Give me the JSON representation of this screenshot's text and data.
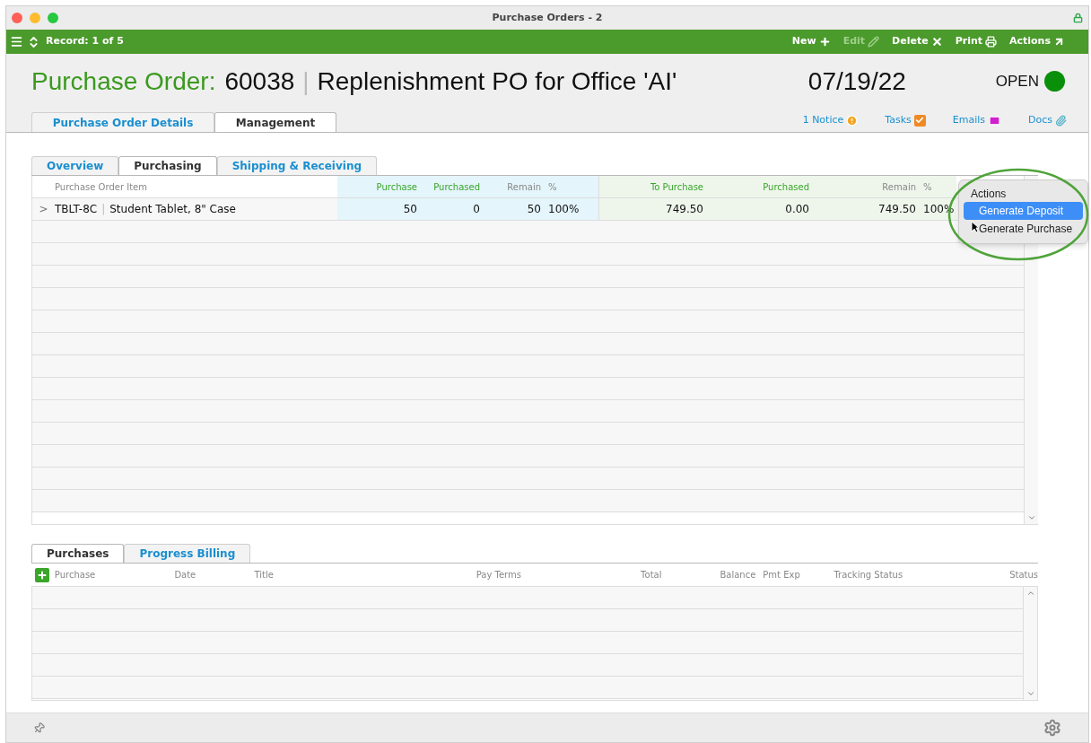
{
  "window": {
    "title": "Purchase Orders - 2"
  },
  "toolbar": {
    "record": "Record: 1 of 5",
    "buttons": [
      {
        "label": "New",
        "kind": "new",
        "disabled": false
      },
      {
        "label": "Edit",
        "kind": "edit",
        "disabled": true
      },
      {
        "label": "Delete",
        "kind": "delete",
        "disabled": false
      },
      {
        "label": "Print",
        "kind": "print",
        "disabled": false
      },
      {
        "label": "Actions",
        "kind": "actions",
        "disabled": false
      }
    ]
  },
  "header": {
    "label": "Purchase Order:",
    "number": "60038",
    "separator": "|",
    "title": "Replenishment PO for Office 'AI'",
    "date": "07/19/22",
    "status": "OPEN"
  },
  "tabs": [
    {
      "label": "Purchase Order Details",
      "selected": false
    },
    {
      "label": "Management",
      "selected": true
    }
  ],
  "links": [
    {
      "label": "1 Notice",
      "kind": "notice"
    },
    {
      "label": "Tasks",
      "kind": "tasks"
    },
    {
      "label": "Emails",
      "kind": "emails"
    },
    {
      "label": "Docs",
      "kind": "docs"
    }
  ],
  "sub_tabs": [
    {
      "label": "Overview",
      "selected": false
    },
    {
      "label": "Purchasing",
      "selected": true
    },
    {
      "label": "Shipping & Receiving",
      "selected": false
    }
  ],
  "items_table": {
    "item_column": "Purchase Order Item",
    "quantity_columns": [
      "Purchase",
      "Purchased",
      "Remain",
      "%"
    ],
    "amount_columns": [
      "To Purchase",
      "Purchased",
      "Remain",
      "%"
    ],
    "rows": [
      {
        "expander": ">",
        "code": "TBLT-8C",
        "separator": "|",
        "description": "Student Tablet, 8\" Case",
        "quantities": [
          "50",
          "0",
          "50",
          "100%"
        ],
        "amounts": [
          "749.50",
          "0.00",
          "749.50",
          "100%"
        ]
      }
    ]
  },
  "actions_menu": {
    "title": "Actions",
    "items": [
      {
        "label": "Generate Deposit",
        "selected": true
      },
      {
        "label": "Generate Purchase",
        "selected": false
      }
    ]
  },
  "bottom_tabs": [
    {
      "label": "Purchases",
      "selected": true
    },
    {
      "label": "Progress Billing",
      "selected": false
    }
  ],
  "purchases_table": {
    "columns": [
      "Purchase",
      "Date",
      "Title",
      "Pay Terms",
      "Total",
      "Balance",
      "Pmt Exp",
      "Tracking Status",
      "Status"
    ]
  }
}
